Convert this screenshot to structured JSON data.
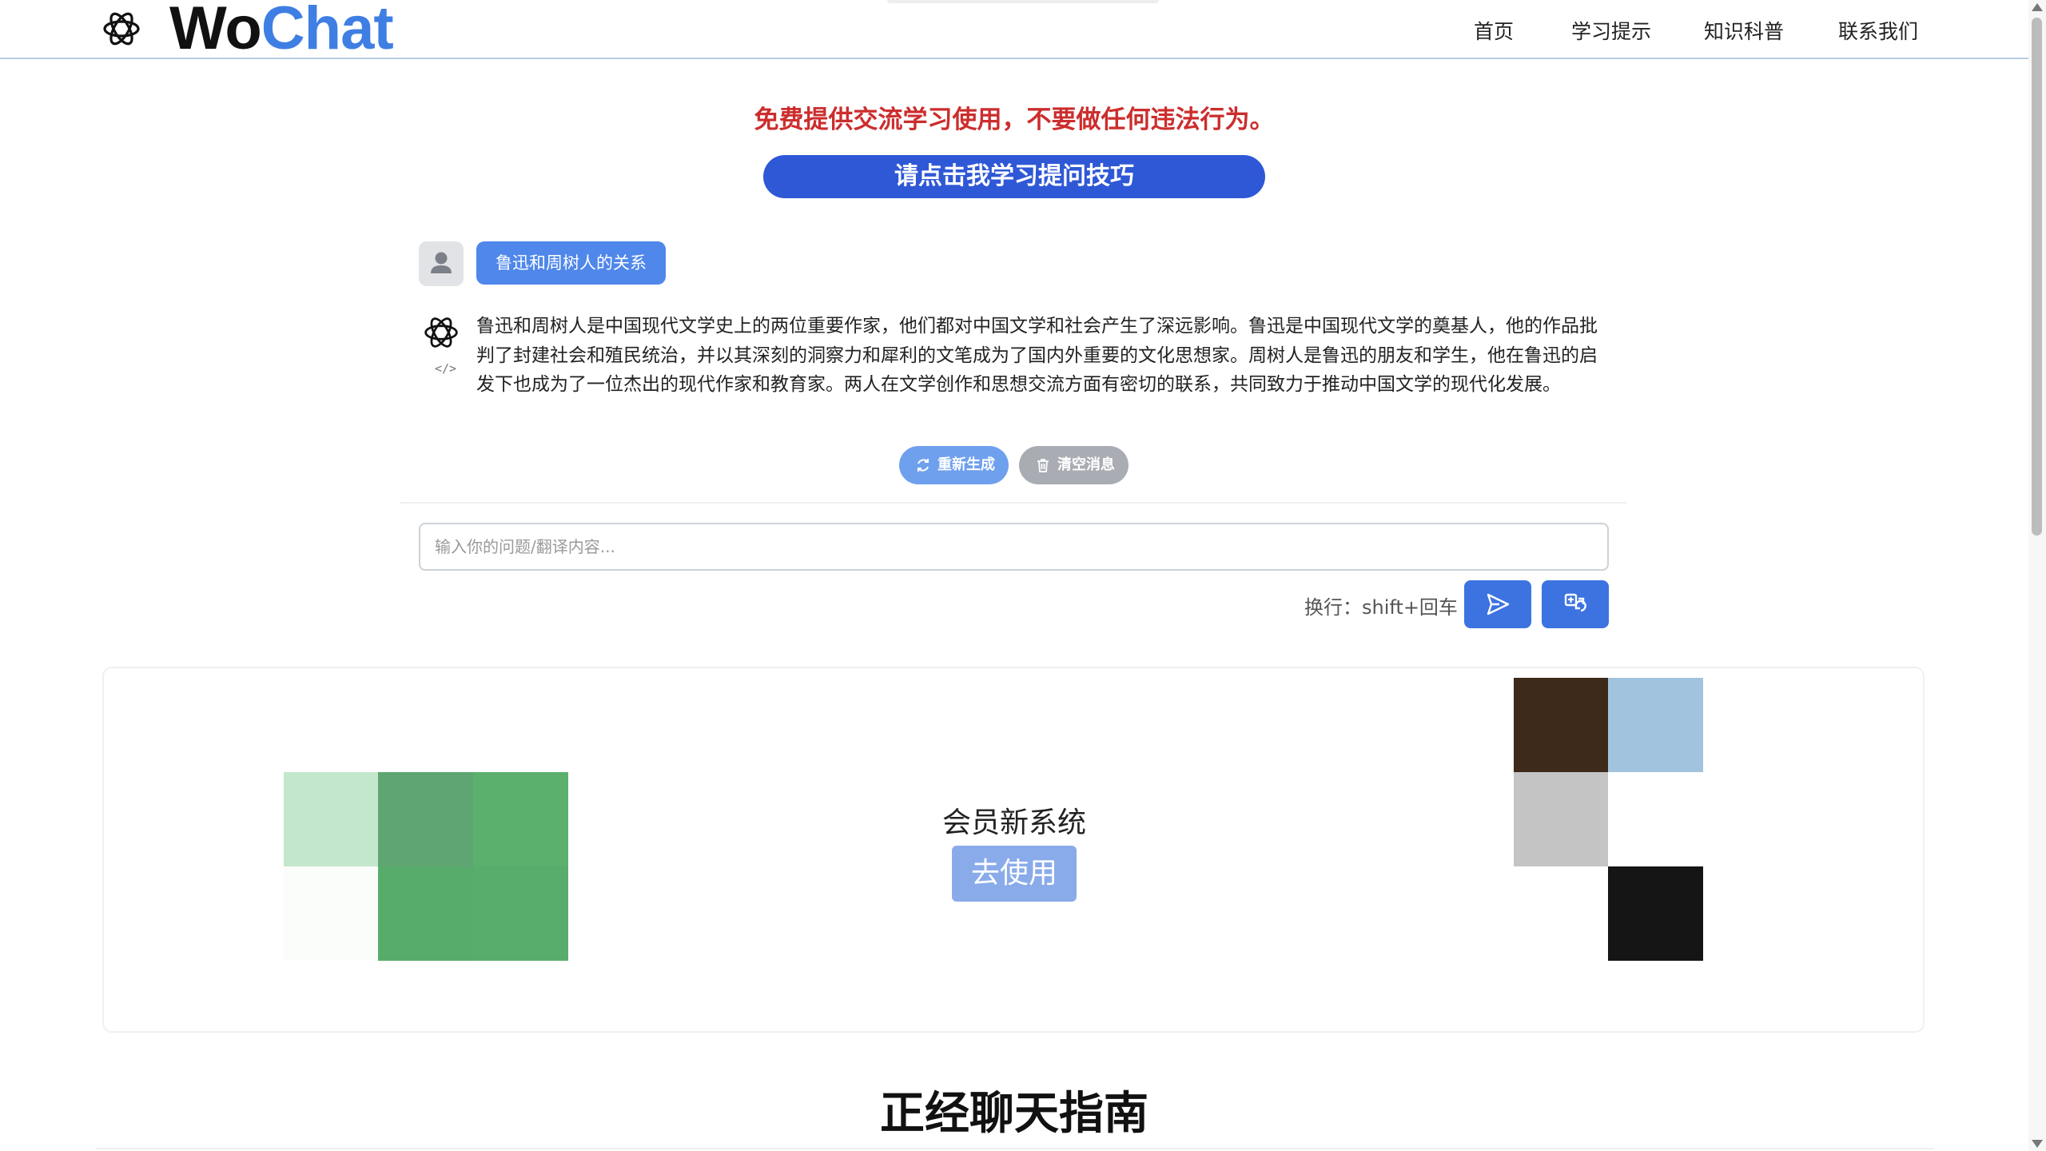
{
  "header": {
    "brand_part1": "Wo",
    "brand_part2": "Chat",
    "nav": [
      "首页",
      "学习提示",
      "知识科普",
      "联系我们"
    ]
  },
  "notice": "免费提供交流学习使用，不要做任何违法行为。",
  "tips_button": "请点击我学习提问技巧",
  "chat": {
    "user_message": "鲁迅和周树人的关系",
    "bot_reply": "鲁迅和周树人是中国现代文学史上的两位重要作家，他们都对中国文学和社会产生了深远影响。鲁迅是中国现代文学的奠基人，他的作品批判了封建社会和殖民统治，并以其深刻的洞察力和犀利的文笔成为了国内外重要的文化思想家。周树人是鲁迅的朋友和学生，他在鲁迅的启发下也成为了一位杰出的现代作家和教育家。两人在文学创作和思想交流方面有密切的联系，共同致力于推动中国文学的现代化发展。",
    "regenerate_label": "重新生成",
    "clear_label": "清空消息",
    "input_placeholder": "输入你的问题/翻译内容...",
    "newline_hint": "换行：shift+回车"
  },
  "member_card": {
    "title": "会员新系统",
    "button": "去使用"
  },
  "guide_title": "正经聊天指南",
  "icons": {
    "logo": "openai-logo-icon",
    "user_avatar": "user-icon",
    "bot_avatar": "openai-logo-icon",
    "code": "code-icon",
    "regenerate": "refresh-icon",
    "clear": "trash-icon",
    "send": "send-icon",
    "translate": "translate-icon"
  },
  "colors": {
    "brand_accent": "#3f7fe3",
    "notice_red": "#cc2d2d",
    "primary_button": "#2f58d6",
    "user_bubble": "#4f87ea",
    "send_button": "#3d73e0"
  }
}
